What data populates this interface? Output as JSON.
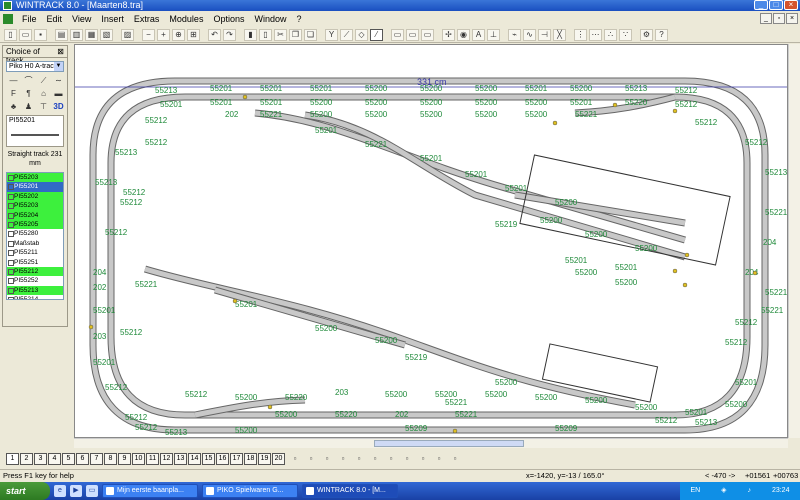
{
  "window": {
    "title": "WINTRACK 8.0 - [Maarten8.tra]"
  },
  "menu": [
    "File",
    "Edit",
    "View",
    "Insert",
    "Extras",
    "Modules",
    "Options",
    "Window",
    "?"
  ],
  "panel": {
    "title": "Choice of track",
    "selected_set": "Piko H0 A-track",
    "preview_id": "PI55201",
    "preview_desc": "Straight track 231 mm",
    "list": [
      {
        "label": "PI55203",
        "state": "green"
      },
      {
        "label": "PI55201",
        "state": "selected"
      },
      {
        "label": "PI55202",
        "state": "green"
      },
      {
        "label": "PI55203",
        "state": "green"
      },
      {
        "label": "PI55204",
        "state": "green"
      },
      {
        "label": "PI55205",
        "state": "green"
      },
      {
        "label": "PI55280",
        "state": "white"
      },
      {
        "label": "Maßstab",
        "state": "white"
      },
      {
        "label": "PI55211",
        "state": "white"
      },
      {
        "label": "PI55251",
        "state": "white"
      },
      {
        "label": "PI55212",
        "state": "green"
      },
      {
        "label": "PI55252",
        "state": "white"
      },
      {
        "label": "PI55213",
        "state": "green"
      },
      {
        "label": "PI55214",
        "state": "white"
      },
      {
        "label": "PI55219",
        "state": "green"
      }
    ]
  },
  "canvas": {
    "dimension_label": "331 cm",
    "labels": [
      "55213",
      "55201",
      "55201",
      "55201",
      "55200",
      "55200",
      "55200",
      "55201",
      "55200",
      "55213",
      "55212",
      "55201",
      "55201",
      "55201",
      "55200",
      "55200",
      "55200",
      "55200",
      "55200",
      "55201",
      "55220",
      "55212",
      "55212",
      "202",
      "55221",
      "55200",
      "55200",
      "55200",
      "55200",
      "55200",
      "55221",
      "55212",
      "55213",
      "55212",
      "55201",
      "55221",
      "55201",
      "55201",
      "55201",
      "55200",
      "55212",
      "55213",
      "55212",
      "55219",
      "55200",
      "55200",
      "55200",
      "55213",
      "55212",
      "55212",
      "55200",
      "55200",
      "55201",
      "55201",
      "204",
      "55201",
      "55221",
      "55201",
      "55200",
      "55200",
      "55219",
      "55200",
      "55221",
      "55201",
      "55212",
      "55212",
      "55212",
      "55200",
      "55220",
      "203",
      "55200",
      "55200",
      "55200",
      "55200",
      "55200",
      "55200",
      "55201",
      "55200",
      "55200",
      "55220",
      "202",
      "55221",
      "55212",
      "55213",
      "55200",
      "55209",
      "55209",
      "55212",
      "55213",
      "55201",
      "55212",
      "204",
      "204",
      "55221",
      "55221",
      "202",
      "203",
      "55212",
      "55212",
      "55221"
    ]
  },
  "bottom": {
    "pages": [
      "1",
      "2",
      "3",
      "4",
      "5",
      "6",
      "7",
      "8",
      "9",
      "10",
      "11",
      "12",
      "13",
      "14",
      "15",
      "16",
      "17",
      "18",
      "19",
      "20"
    ]
  },
  "status": {
    "help": "Press F1 key for help",
    "coords": "x=-1420, y=-13 / 165.0°",
    "zoom": "< -470 ->",
    "pos1": "+01561",
    "pos2": "+00763"
  },
  "taskbar": {
    "start": "start",
    "tasks": [
      "Mijn eerste baanpla...",
      "PIKO Spielwaren G...",
      "WINTRACK 8.0 - [M..."
    ],
    "lang": "EN",
    "clock": "23:24"
  }
}
